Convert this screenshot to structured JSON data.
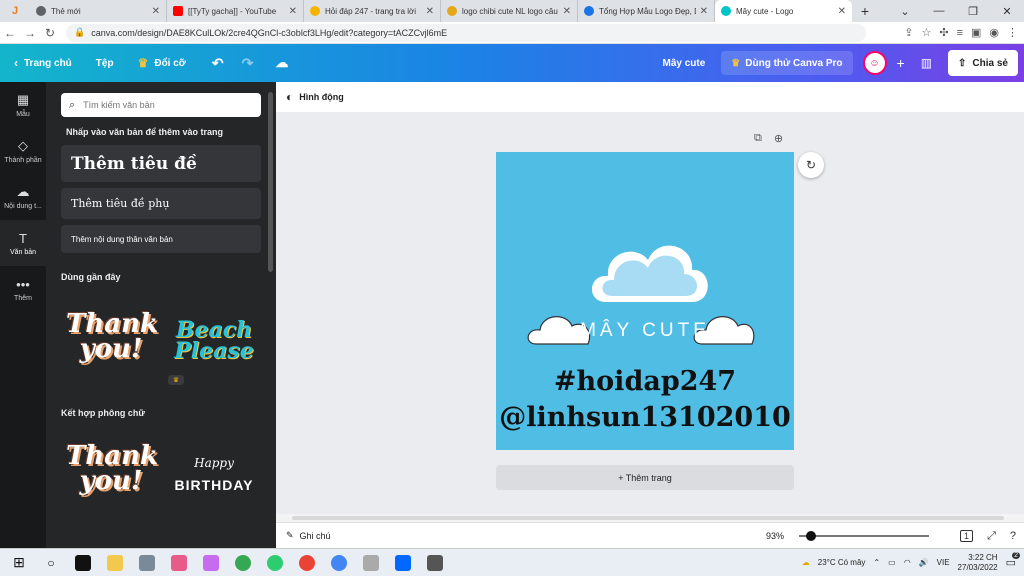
{
  "browser": {
    "tabs": [
      {
        "label": "Thẻ mới",
        "icon_color": "#5f6368",
        "active": false
      },
      {
        "label": "[[TyTy gacha]] - YouTube",
        "icon_color": "#ff0000",
        "active": false
      },
      {
        "label": "Hỏi đáp 247 - trang tra lời",
        "icon_color": "#f4b400",
        "active": false
      },
      {
        "label": "logo chibi cute NL logo câu",
        "icon_color": "#e6a817",
        "active": false
      },
      {
        "label": "Tổng Hợp Mẫu Logo Đẹp, D",
        "icon_color": "#1a73e8",
        "active": false
      },
      {
        "label": "Mây cute - Logo",
        "icon_color": "#00c4cc",
        "active": true
      }
    ],
    "first_tab_glyph": "J",
    "new_tab": "+",
    "url": "canva.com/design/DAE8KCulLOk/2cre4QGnCl-c3oblcf3LHg/edit?category=tACZCvjl6mE"
  },
  "toolbar": {
    "home": "Trang chủ",
    "file": "Tệp",
    "resize": "Đổi cỡ",
    "doc_title": "Mây cute",
    "pro": "Dùng thử Canva Pro",
    "share": "Chia sẻ"
  },
  "rail": [
    {
      "label": "Mẫu",
      "icon": "template-icon",
      "glyph": "▦"
    },
    {
      "label": "Thành phần",
      "icon": "elements-icon",
      "glyph": "◇"
    },
    {
      "label": "Nội dung t...",
      "icon": "upload-icon",
      "glyph": "☁"
    },
    {
      "label": "Văn bản",
      "icon": "text-icon",
      "glyph": "T"
    },
    {
      "label": "Thêm",
      "icon": "more-icon",
      "glyph": "•••"
    }
  ],
  "panel": {
    "search_placeholder": "Tìm kiếm văn bản",
    "instruction": "Nhấp vào văn bản để thêm vào trang",
    "heading": "Thêm tiêu đề",
    "subheading": "Thêm tiêu đề phụ",
    "body": "Thêm nội dung thân văn bản",
    "recent": "Dùng gần đây",
    "combos": "Kết hợp phông chữ",
    "stickers": {
      "thank_you": "Thank you!",
      "beach": "Beach Please",
      "happy": "Happy",
      "birthday": "BIRTHDAY"
    }
  },
  "editor": {
    "animate": "Hình động",
    "add_page": "+ Thêm trang",
    "notes": "Ghi chú",
    "zoom": "93%",
    "zoom_fraction": 0.05,
    "page_number": "1"
  },
  "design": {
    "background": "#50bde5",
    "logo_text": "MÂY CUTE",
    "line1": "#hoidap247",
    "line2": "@linhsun13102010"
  },
  "taskbar": {
    "weather": "23°C  Có mây",
    "lang": "VIE",
    "time": "3:22 CH",
    "date": "27/03/2022",
    "notify": "2"
  }
}
